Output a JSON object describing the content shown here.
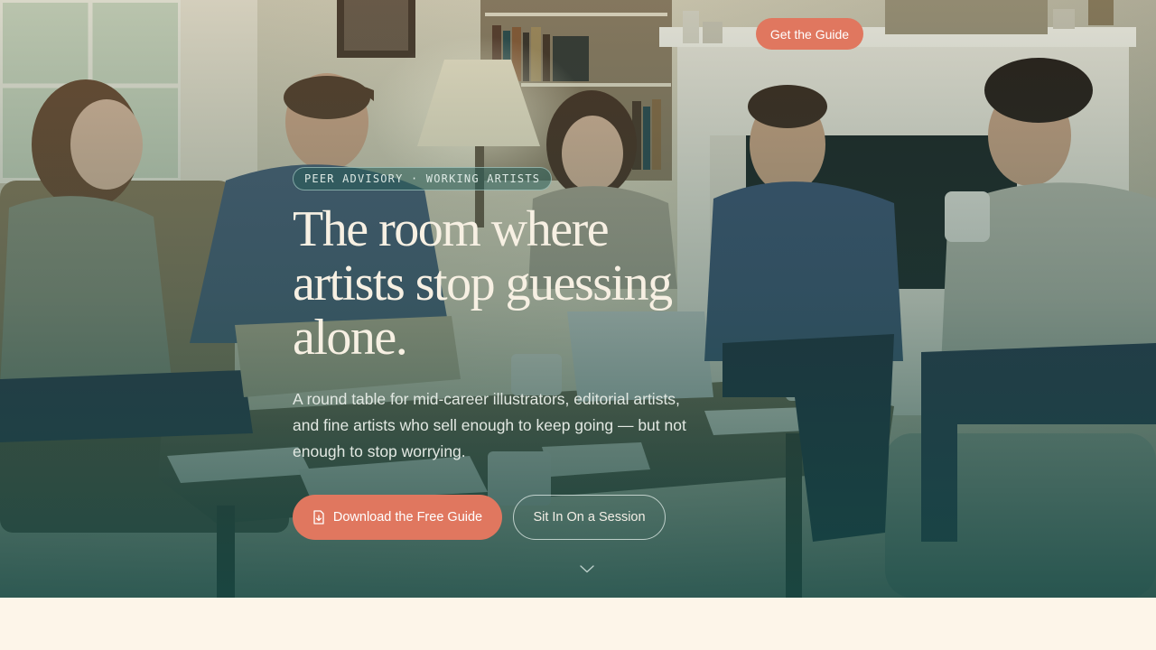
{
  "nav": {
    "cta_label": "Get the Guide"
  },
  "hero": {
    "eyebrow": "PEER ADVISORY · WORKING ARTISTS",
    "headline_lines": [
      "The room where",
      "artists stop guessing",
      "alone."
    ],
    "lede": "A round table for mid-career illustrators, editorial artists, and fine artists who sell enough to keep going — but not enough to stop worrying.",
    "primary_cta": {
      "label": "Download the Free Guide",
      "icon": "download-document-icon"
    },
    "secondary_cta": {
      "label": "Sit In On a Session"
    },
    "scroll_icon": "chevron-down-icon",
    "background_image": "photo-peer-group-meeting-living-room"
  },
  "colors": {
    "accent": "#e0775f",
    "overlay_teal": "#1b4a47",
    "headline": "#f7f0e3",
    "page_background": "#fdf5e9"
  }
}
